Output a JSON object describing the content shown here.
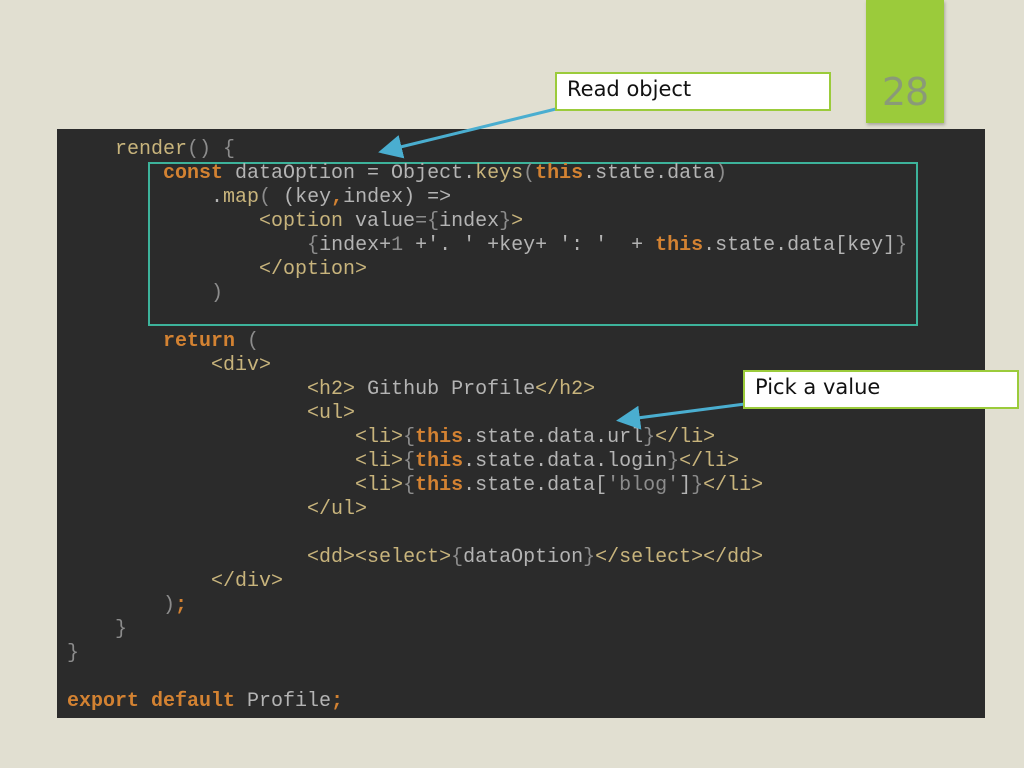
{
  "slide_number": "28",
  "callouts": {
    "read_object": "Read object",
    "pick_value": "Pick a value"
  },
  "colors": {
    "accent": "#9bcb3b",
    "highlight_box": "#3db39b",
    "arrow": "#4aaed0",
    "code_bg": "#2b2b2b"
  },
  "code": [
    [
      [
        "",
        "    "
      ],
      [
        "t",
        "render"
      ],
      [
        "p",
        "() {"
      ]
    ],
    [
      [
        "",
        "        "
      ],
      [
        "k",
        "const"
      ],
      [
        "i",
        " dataOption = Object."
      ],
      [
        "t",
        "keys"
      ],
      [
        "p",
        "("
      ],
      [
        "k",
        "this"
      ],
      [
        "i",
        ".state.data"
      ],
      [
        "p",
        ")"
      ]
    ],
    [
      [
        "",
        "            "
      ],
      [
        "i",
        "."
      ],
      [
        "t",
        "map"
      ],
      [
        "p",
        "( "
      ],
      [
        "i",
        "(key"
      ],
      [
        "k",
        ","
      ],
      [
        "i",
        "index) =>"
      ]
    ],
    [
      [
        "",
        "                "
      ],
      [
        "t",
        "<option"
      ],
      [
        "i",
        " value"
      ],
      [
        "p",
        "={"
      ],
      [
        "i",
        "index"
      ],
      [
        "p",
        "}"
      ],
      [
        "t",
        ">"
      ]
    ],
    [
      [
        "",
        "                    "
      ],
      [
        "p",
        "{"
      ],
      [
        "i",
        "index+"
      ],
      [
        "p",
        "1"
      ],
      [
        "i",
        " +'. ' +key+ ': '  + "
      ],
      [
        "k",
        "this"
      ],
      [
        "i",
        ".state.data[key]"
      ],
      [
        "p",
        "}"
      ]
    ],
    [
      [
        "",
        "                "
      ],
      [
        "t",
        "</option>"
      ]
    ],
    [
      [
        "",
        "            "
      ],
      [
        "p",
        ")"
      ]
    ],
    [
      [
        "",
        ""
      ]
    ],
    [
      [
        "",
        "        "
      ],
      [
        "k",
        "return"
      ],
      [
        "p",
        " ("
      ]
    ],
    [
      [
        "",
        "            "
      ],
      [
        "t",
        "<div>"
      ]
    ],
    [
      [
        "",
        "                    "
      ],
      [
        "t",
        "<h2>"
      ],
      [
        "i",
        " Github Profile"
      ],
      [
        "t",
        "</h2>"
      ]
    ],
    [
      [
        "",
        "                    "
      ],
      [
        "t",
        "<ul>"
      ]
    ],
    [
      [
        "",
        "                        "
      ],
      [
        "t",
        "<li>"
      ],
      [
        "p",
        "{"
      ],
      [
        "k",
        "this"
      ],
      [
        "i",
        ".state.data.url"
      ],
      [
        "p",
        "}"
      ],
      [
        "t",
        "</li>"
      ]
    ],
    [
      [
        "",
        "                        "
      ],
      [
        "t",
        "<li>"
      ],
      [
        "p",
        "{"
      ],
      [
        "k",
        "this"
      ],
      [
        "i",
        ".state.data.login"
      ],
      [
        "p",
        "}"
      ],
      [
        "t",
        "</li>"
      ]
    ],
    [
      [
        "",
        "                        "
      ],
      [
        "t",
        "<li>"
      ],
      [
        "p",
        "{"
      ],
      [
        "k",
        "this"
      ],
      [
        "i",
        ".state.data["
      ],
      [
        "p",
        "'blog'"
      ],
      [
        "i",
        "]"
      ],
      [
        "p",
        "}"
      ],
      [
        "t",
        "</li>"
      ]
    ],
    [
      [
        "",
        "                    "
      ],
      [
        "t",
        "</ul>"
      ]
    ],
    [
      [
        "",
        ""
      ]
    ],
    [
      [
        "",
        "                    "
      ],
      [
        "t",
        "<dd><select>"
      ],
      [
        "p",
        "{"
      ],
      [
        "i",
        "dataOption"
      ],
      [
        "p",
        "}"
      ],
      [
        "t",
        "</select></dd>"
      ]
    ],
    [
      [
        "",
        "            "
      ],
      [
        "t",
        "</div>"
      ]
    ],
    [
      [
        "",
        "        "
      ],
      [
        "p",
        ")"
      ],
      [
        "k",
        ";"
      ]
    ],
    [
      [
        "",
        "    "
      ],
      [
        "p",
        "}"
      ]
    ],
    [
      [
        "",
        ""
      ],
      [
        "p",
        "}"
      ]
    ],
    [
      [
        "",
        ""
      ]
    ],
    [
      [
        "",
        ""
      ],
      [
        "k",
        "export default"
      ],
      [
        "i",
        " Profile"
      ],
      [
        "k",
        ";"
      ]
    ]
  ]
}
